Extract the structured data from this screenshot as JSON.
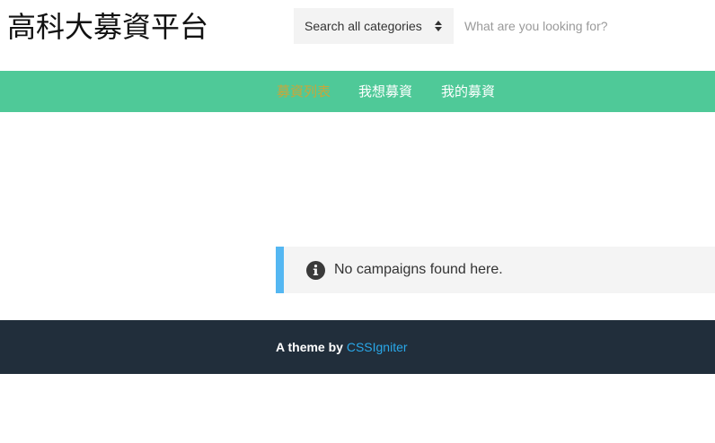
{
  "header": {
    "site_title": "高科大募資平台",
    "category_select": {
      "selected": "Search all categories"
    },
    "search": {
      "placeholder": "What are you looking for?",
      "value": ""
    }
  },
  "nav": {
    "items": [
      {
        "label": "募資列表",
        "active": true
      },
      {
        "label": "我想募資",
        "active": false
      },
      {
        "label": "我的募資",
        "active": false
      }
    ]
  },
  "notice": {
    "icon": "info-icon",
    "text": "No campaigns found here."
  },
  "footer": {
    "prefix": "A theme by ",
    "link_label": "CSSIgniter"
  },
  "colors": {
    "nav_bg": "#4fc998",
    "nav_active": "#c8a63a",
    "notice_accent": "#54b7f2",
    "footer_bg": "#212e3b",
    "footer_link": "#29a8e9"
  }
}
